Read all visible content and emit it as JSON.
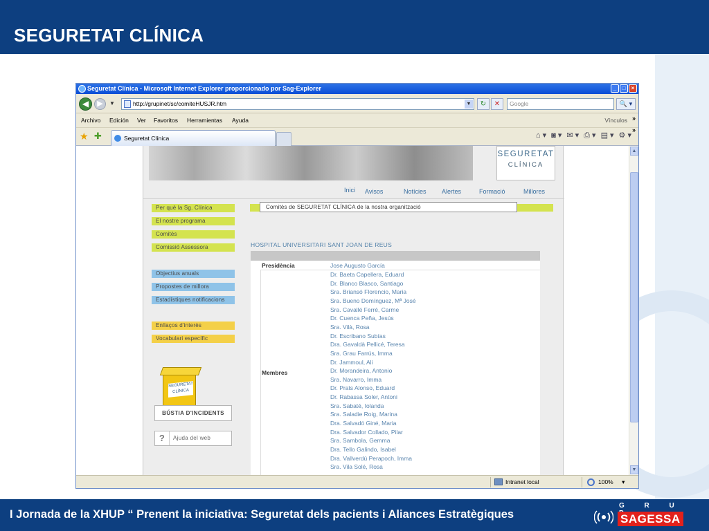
{
  "slide": {
    "title": "SEGURETAT CLÍNICA",
    "footer": "I Jornada de la XHUP “ Prenent la iniciativa: Seguretat dels pacients i Aliances Estratègiques",
    "logo_top": "G R U P",
    "logo_name": "SAGESSA",
    "colors": {
      "band": "#0d3f80",
      "logo_red": "#e2211c"
    }
  },
  "browser": {
    "window_title": "Seguretat Clínica - Microsoft Internet Explorer proporcionado por Sag-Explorer",
    "window_buttons": {
      "minimize": "_",
      "maximize": "□",
      "close": "×"
    },
    "nav": {
      "back": "◀",
      "forward": "▶",
      "dropdown": "▼"
    },
    "url": "http://grupinet/sc/comiteHUSJR.htm",
    "url_dropdown": "▼",
    "refresh": "↻",
    "stop": "✕",
    "search_placeholder": "Google",
    "search_button": "🔍 ▾",
    "menu": [
      "Archivo",
      "Edición",
      "Ver",
      "Favoritos",
      "Herramientas",
      "Ayuda"
    ],
    "links_label": "Vínculos",
    "chevron": "»",
    "fav_star": "★",
    "add_fav": "✚",
    "tab_title": "Seguretat Clínica",
    "cmd_icons": {
      "home": "⌂ ▾",
      "feeds": "◙ ▾",
      "mail": "✉ ▾",
      "print": "⎙ ▾",
      "page": "▤ ▾",
      "tools": "⚙ ▾"
    },
    "scroll_up": "▲",
    "scroll_down": "▼",
    "status_zone": "Intranet local",
    "status_zoom": "100%",
    "zoom_dropdown": "▾"
  },
  "page": {
    "logo_line1": "SEGURETAT",
    "logo_line2": "CLÍNICA",
    "nav": [
      "Inici",
      "Avisos",
      "Notícies",
      "Alertes",
      "Formació",
      "Millores"
    ],
    "sidebar_green": [
      "Per què la Sg. Clínica",
      "El nostre programa",
      "Comitès",
      "Comissió Assessora"
    ],
    "sidebar_blue": [
      "Objectius anuals",
      "Propostes de millora",
      "Estadístiques notificacions"
    ],
    "sidebar_yellow": [
      "Enllaços d'interès",
      "Vocabulari específic"
    ],
    "mailbox_label": "SEGURETAT CLÍNICA",
    "bustia": "BÚSTIA D'INCIDENTS",
    "help_icon": "?",
    "ajuda": "Ajuda del web",
    "comites_heading": "Comitès de SEGURETAT CLÍNICA de la nostra organització",
    "hospital": "HOSPITAL UNIVERSITARI SANT JOAN DE REUS",
    "presidencia_label": "Presidència",
    "presidencia_value": "Jose Augusto García",
    "membres_label": "Membres",
    "membres": [
      "Dr. Baeta Capellera, Eduard",
      "Dr. Blanco Blasco, Santiago",
      "Sra. Briansó Florencio, Maria",
      "Sra. Bueno Domínguez, Mª José",
      "Sra. Cavallé Ferré, Carme",
      "Dr. Cuenca Peña, Jesús",
      "Sra. Vilà, Rosa",
      "Dr. Escribano Subías",
      "Dra. Gavaldà Pellicé, Teresa",
      "Sra. Grau Farrús, Imma",
      "Dr. Jammoul, Ali",
      "Dr. Morandeira, Antonio",
      "Sra. Navarro, Imma",
      "Dr. Prats Alonso, Eduard",
      "Dr. Rabassa Soler, Antoni",
      "Sra. Sabaté, Iolanda",
      "Sra. Saladie Roig, Marina",
      "Dra. Salvadó Giné, Maria",
      "Dra. Salvador Collado, Pilar",
      "Sra. Sambola, Gemma",
      "Dra. Tello Galindo, Isabel",
      "Dra. Vallverdú Perapoch, Imma",
      "Sra. Vila Solé, Rosa"
    ]
  }
}
